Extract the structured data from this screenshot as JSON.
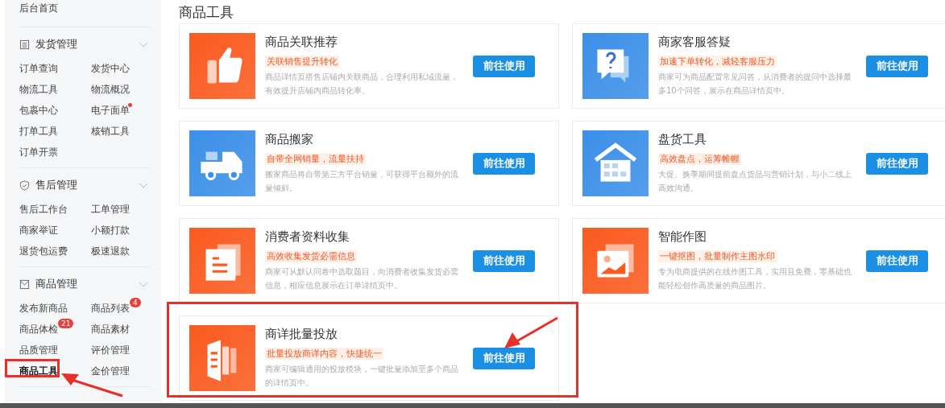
{
  "sidebar": {
    "home": "后台首页",
    "sections": [
      {
        "title": "发货管理",
        "items": [
          {
            "label": "订单查询",
            "selected": false
          },
          {
            "label": "发货中心",
            "selected": false
          },
          {
            "label": "物流工具",
            "selected": false
          },
          {
            "label": "物流概况",
            "selected": false
          },
          {
            "label": "包裹中心",
            "selected": false
          },
          {
            "label": "电子面单",
            "selected": false,
            "dot": true
          },
          {
            "label": "打单工具",
            "selected": false
          },
          {
            "label": "核销工具",
            "selected": false
          },
          {
            "label": "订单开票",
            "selected": false
          }
        ]
      },
      {
        "title": "售后管理",
        "items": [
          {
            "label": "售后工作台",
            "selected": false
          },
          {
            "label": "工单管理",
            "selected": false
          },
          {
            "label": "商家举证",
            "selected": false
          },
          {
            "label": "小额打款",
            "selected": false
          },
          {
            "label": "退货包运费",
            "selected": false
          },
          {
            "label": "极速退款",
            "selected": false
          }
        ]
      },
      {
        "title": "商品管理",
        "items": [
          {
            "label": "发布新商品",
            "selected": false
          },
          {
            "label": "商品列表",
            "selected": false,
            "badge": "4"
          },
          {
            "label": "商品体检",
            "selected": false,
            "badge": "21"
          },
          {
            "label": "商品素材",
            "selected": false
          },
          {
            "label": "品质管理",
            "selected": false
          },
          {
            "label": "评价管理",
            "selected": false
          },
          {
            "label": "商品工具",
            "selected": true
          },
          {
            "label": "金价管理",
            "selected": false
          }
        ]
      }
    ]
  },
  "page_title": "商品工具",
  "tools": [
    {
      "title": "商品关联推荐",
      "tag": "关联销售提升转化",
      "description": "商品详情页搭售店铺内关联商品，合理利用私域流量，有效提升店铺内商品转化率。",
      "button": "前往使用",
      "color": "#fa5a1e"
    },
    {
      "title": "商家客服答疑",
      "tag": "加速下单转化，减轻客服压力",
      "description": "商家可为商品配置常见问答，从消费者的提问中选择最多10个问答，展示在商品详情页中。",
      "button": "前往使用",
      "color": "#3b8fe8"
    },
    {
      "title": "商品搬家",
      "tag": "自带全网销量，流量扶持",
      "description": "搬家商品将自带第三方平台销量，可获得平台额外的流量倾斜。",
      "button": "前往使用",
      "color": "#3b8fe8"
    },
    {
      "title": "盘货工具",
      "tag": "高效盘点，运筹帷幄",
      "description": "大促、换季期间提前盘点货品与营销计划，与小二线上高效沟通。",
      "button": "前往使用",
      "color": "#3b8fe8"
    },
    {
      "title": "消费者资料收集",
      "tag": "高效收集发货必需信息",
      "description": "商家可从默认问卷中选取题目，向消费者收集发货必需信息，相应信息展示在订单详情页中。",
      "button": "前往使用",
      "color": "#fa5a1e"
    },
    {
      "title": "智能作图",
      "tag": "一键抠图，批量制作主图水印",
      "description": "专为电商提供的在线作图工具，实用且免费，零基础也能轻松创作高质量的商品图片。",
      "button": "前往使用",
      "color": "#fa5a1e"
    },
    {
      "title": "商详批量投放",
      "tag": "批量投放商详内容，快捷统一",
      "description": "商家可编辑通用的投放模块，一键批量添加至多个商品的详情页中。",
      "button": "前往使用",
      "color": "#fa5a1e"
    }
  ]
}
